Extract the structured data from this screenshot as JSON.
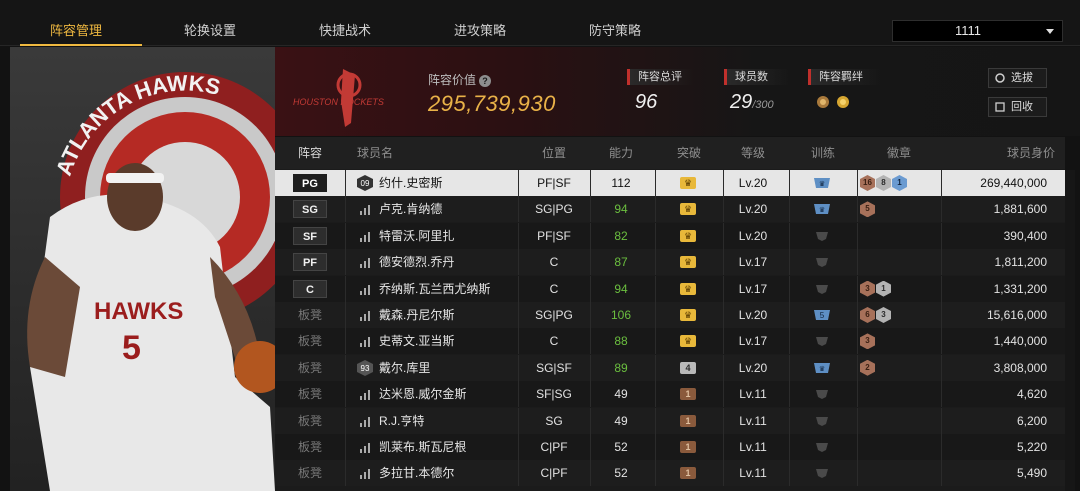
{
  "tabs": [
    {
      "label": "阵容管理",
      "active": true
    },
    {
      "label": "轮换设置",
      "active": false
    },
    {
      "label": "快捷战术",
      "active": false
    },
    {
      "label": "进攻策略",
      "active": false
    },
    {
      "label": "防守策略",
      "active": false
    }
  ],
  "team_select": {
    "value": "1111"
  },
  "art": {
    "player_jersey_team": "HAWKS",
    "player_jersey_number": "5",
    "logo_text": "ATLANTA HAWKS"
  },
  "header": {
    "team_logo_text": "HOUSTON ROCKETS",
    "value_label": "阵容价值",
    "value": "295,739,930",
    "rating_label": "阵容总评",
    "rating": "96",
    "players_label": "球员数",
    "players": "29",
    "players_max": "/300",
    "chem_label": "阵容羁绊",
    "btn_select": "选拔",
    "btn_recycle": "回收"
  },
  "columns": [
    "阵容",
    "球员名",
    "位置",
    "能力",
    "突破",
    "等级",
    "训练",
    "徽章",
    "球员身价"
  ],
  "colors": {
    "accent": "#f0b940",
    "red": "#c0302c",
    "green": "#6bbf3f"
  },
  "rows": [
    {
      "slot": "PG",
      "starter": true,
      "num": "09",
      "name": "约什.史密斯",
      "pos": "PF|SF",
      "ovr": "112",
      "green": false,
      "brk": "gold",
      "lvl": "Lv.20",
      "train": "blue",
      "badges": [
        [
          "b-bronze",
          "16"
        ],
        [
          "b-silver",
          "8"
        ],
        [
          "b-blue",
          "1"
        ]
      ],
      "price": "269,440,000"
    },
    {
      "slot": "SG",
      "starter": true,
      "num": "",
      "name": "卢克.肯纳德",
      "pos": "SG|PG",
      "ovr": "94",
      "green": true,
      "brk": "gold",
      "lvl": "Lv.20",
      "train": "blue",
      "badges": [
        [
          "b-bronze",
          "5"
        ]
      ],
      "price": "1,881,600"
    },
    {
      "slot": "SF",
      "starter": true,
      "num": "",
      "name": "特雷沃.阿里扎",
      "pos": "PF|SF",
      "ovr": "82",
      "green": true,
      "brk": "gold",
      "lvl": "Lv.20",
      "train": "grey",
      "badges": [],
      "price": "390,400"
    },
    {
      "slot": "PF",
      "starter": true,
      "num": "",
      "name": "德安德烈.乔丹",
      "pos": "C",
      "ovr": "87",
      "green": true,
      "brk": "gold",
      "lvl": "Lv.17",
      "train": "grey",
      "badges": [],
      "price": "1,811,200"
    },
    {
      "slot": "C",
      "starter": true,
      "num": "",
      "name": "乔纳斯.瓦兰西尤纳斯",
      "pos": "C",
      "ovr": "94",
      "green": true,
      "brk": "gold",
      "lvl": "Lv.17",
      "train": "grey",
      "badges": [
        [
          "b-bronze",
          "3"
        ],
        [
          "b-silver",
          "1"
        ]
      ],
      "price": "1,331,200"
    },
    {
      "slot": "板凳",
      "starter": false,
      "num": "",
      "name": "戴森.丹尼尔斯",
      "pos": "SG|PG",
      "ovr": "106",
      "green": true,
      "brk": "gold",
      "lvl": "Lv.20",
      "train": "blue5",
      "badges": [
        [
          "b-bronze",
          "6"
        ],
        [
          "b-silver",
          "3"
        ]
      ],
      "price": "15,616,000"
    },
    {
      "slot": "板凳",
      "starter": false,
      "num": "",
      "name": "史蒂文.亚当斯",
      "pos": "C",
      "ovr": "88",
      "green": true,
      "brk": "gold",
      "lvl": "Lv.17",
      "train": "grey",
      "badges": [
        [
          "b-bronze",
          "3"
        ]
      ],
      "price": "1,440,000"
    },
    {
      "slot": "板凳",
      "starter": false,
      "num": "93",
      "name": "戴尔.库里",
      "pos": "SG|SF",
      "ovr": "89",
      "green": true,
      "brk": "silver4",
      "lvl": "Lv.20",
      "train": "blue",
      "badges": [
        [
          "b-bronze",
          "2"
        ]
      ],
      "price": "3,808,000"
    },
    {
      "slot": "板凳",
      "starter": false,
      "num": "",
      "name": "达米恩.威尔金斯",
      "pos": "SF|SG",
      "ovr": "49",
      "green": false,
      "brk": "bronze",
      "lvl": "Lv.11",
      "train": "grey",
      "badges": [],
      "price": "4,620"
    },
    {
      "slot": "板凳",
      "starter": false,
      "num": "",
      "name": "R.J.亨特",
      "pos": "SG",
      "ovr": "49",
      "green": false,
      "brk": "bronze",
      "lvl": "Lv.11",
      "train": "grey",
      "badges": [],
      "price": "6,200"
    },
    {
      "slot": "板凳",
      "starter": false,
      "num": "",
      "name": "凯莱布.斯瓦尼根",
      "pos": "C|PF",
      "ovr": "52",
      "green": false,
      "brk": "bronze",
      "lvl": "Lv.11",
      "train": "grey",
      "badges": [],
      "price": "5,220"
    },
    {
      "slot": "板凳",
      "starter": false,
      "num": "",
      "name": "多拉甘.本德尔",
      "pos": "C|PF",
      "ovr": "52",
      "green": false,
      "brk": "bronze",
      "lvl": "Lv.11",
      "train": "grey",
      "badges": [],
      "price": "5,490"
    }
  ]
}
